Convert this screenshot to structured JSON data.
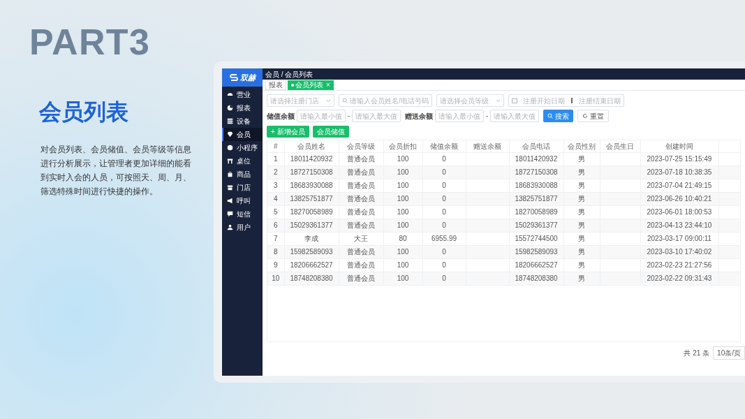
{
  "slide": {
    "part": "PART3",
    "heading": "会员列表",
    "description": "对会员列表、会员储值、会员等级等信息进行分析展示，让管理者更加详细的能看到实时入会的人员，可按照天、周、月、筛选特殊时间进行快捷的操作。"
  },
  "app": {
    "logo": "双赫",
    "sidebar": {
      "items": [
        {
          "label": "营业",
          "selected": false
        },
        {
          "label": "报表",
          "selected": false
        },
        {
          "label": "设备",
          "selected": false
        },
        {
          "label": "会员",
          "selected": true
        },
        {
          "label": "小程序",
          "selected": false
        },
        {
          "label": "桌位",
          "selected": false
        },
        {
          "label": "商品",
          "selected": false
        },
        {
          "label": "门店",
          "selected": false
        },
        {
          "label": "呼叫",
          "selected": false
        },
        {
          "label": "短信",
          "selected": false
        },
        {
          "label": "用户",
          "selected": false
        }
      ]
    },
    "breadcrumb": "会员 / 会员列表",
    "tabs": [
      {
        "label": "报表",
        "selected": false
      },
      {
        "label": "会员列表",
        "selected": true,
        "close": "×"
      }
    ],
    "filters": [
      {
        "kind": "select",
        "placeholder": "请选择注册门店"
      },
      {
        "kind": "search",
        "placeholder": "请输入会员姓名/电话号码"
      },
      {
        "kind": "select",
        "placeholder": "请选择会员等级"
      },
      {
        "kind": "daterange",
        "start": "注册开始日期",
        "end": "注册结束日期"
      },
      {
        "kind": "range",
        "label": "储值余额",
        "min": "请输入最小值",
        "max": "请输入最大值"
      },
      {
        "kind": "range",
        "label": "赠送余额",
        "min": "请输入最小值",
        "max": "请输入最大值"
      }
    ],
    "search_button": "搜索",
    "reset_button": "重置",
    "actions": [
      "+ 新增会员",
      "会员储值"
    ],
    "table": {
      "columns": [
        "#",
        "会员姓名",
        "会员等级",
        "会员折扣",
        "储值余额",
        "赠送余额",
        "会员电话",
        "会员性别",
        "会员生日",
        "创建时间"
      ],
      "rows": [
        [
          "1",
          "18011420932",
          "普通会员",
          "100",
          "0",
          "",
          "18011420932",
          "男",
          "",
          "2023-07-25 15:15:49"
        ],
        [
          "2",
          "18727150308",
          "普通会员",
          "100",
          "0",
          "",
          "18727150308",
          "男",
          "",
          "2023-07-18 10:38:35"
        ],
        [
          "3",
          "18683930088",
          "普通会员",
          "100",
          "0",
          "",
          "18683930088",
          "男",
          "",
          "2023-07-04 21:49:15"
        ],
        [
          "4",
          "13825751877",
          "普通会员",
          "100",
          "0",
          "",
          "13825751877",
          "男",
          "",
          "2023-06-26 10:40:21"
        ],
        [
          "5",
          "18270058989",
          "普通会员",
          "100",
          "0",
          "",
          "18270058989",
          "男",
          "",
          "2023-06-01 18:00:53"
        ],
        [
          "6",
          "15029361377",
          "普通会员",
          "100",
          "0",
          "",
          "15029361377",
          "男",
          "",
          "2023-04-13 23:44:10"
        ],
        [
          "7",
          "李成",
          "大王",
          "80",
          "6955.99",
          "",
          "15572744500",
          "男",
          "",
          "2023-03-17 09:00:11"
        ],
        [
          "8",
          "15982589093",
          "普通会员",
          "100",
          "0",
          "",
          "15982589093",
          "男",
          "",
          "2023-03-10 17:40:02"
        ],
        [
          "9",
          "18206662527",
          "普通会员",
          "100",
          "0",
          "",
          "18206662527",
          "男",
          "",
          "2023-02-23 21:27:56"
        ],
        [
          "10",
          "18748208380",
          "普通会员",
          "100",
          "0",
          "",
          "18748208380",
          "男",
          "",
          "2023-02-22 09:31:43"
        ]
      ]
    },
    "pagination": {
      "total": "共 21 条",
      "page_size": "10条/页"
    }
  }
}
